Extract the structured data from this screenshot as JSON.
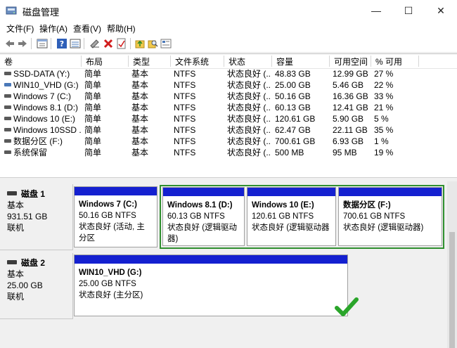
{
  "window": {
    "title": "磁盘管理",
    "minimize": "—",
    "maximize": "☐",
    "close": "✕"
  },
  "menu": [
    "文件(F)",
    "操作(A)",
    "查看(V)",
    "帮助(H)"
  ],
  "toolbar_icons": [
    "back-arrow-icon",
    "forward-arrow-icon",
    "console-icon",
    "help-icon",
    "properties-icon",
    "map-drive-icon",
    "delete-icon",
    "check-icon",
    "up-folder-icon",
    "search-icon",
    "details-icon"
  ],
  "volume_table": {
    "headers": [
      "卷",
      "布局",
      "类型",
      "文件系统",
      "状态",
      "容量",
      "可用空间",
      "% 可用"
    ],
    "rows": [
      [
        "SSD-DATA (Y:)",
        "简单",
        "基本",
        "NTFS",
        "状态良好 (...",
        "48.83 GB",
        "12.99 GB",
        "27 %"
      ],
      [
        "WIN10_VHD (G:)",
        "简单",
        "基本",
        "NTFS",
        "状态良好 (...",
        "25.00 GB",
        "5.46 GB",
        "22 %"
      ],
      [
        "Windows 7 (C:)",
        "简单",
        "基本",
        "NTFS",
        "状态良好 (...",
        "50.16 GB",
        "16.36 GB",
        "33 %"
      ],
      [
        "Windows 8.1 (D:)",
        "简单",
        "基本",
        "NTFS",
        "状态良好 (...",
        "60.13 GB",
        "12.41 GB",
        "21 %"
      ],
      [
        "Windows 10 (E:)",
        "简单",
        "基本",
        "NTFS",
        "状态良好 (...",
        "120.61 GB",
        "5.90 GB",
        "5 %"
      ],
      [
        "Windows 10SSD ...",
        "简单",
        "基本",
        "NTFS",
        "状态良好 (...",
        "62.47 GB",
        "22.11 GB",
        "35 %"
      ],
      [
        "数据分区 (F:)",
        "简单",
        "基本",
        "NTFS",
        "状态良好 (...",
        "700.61 GB",
        "6.93 GB",
        "1 %"
      ],
      [
        "系统保留",
        "简单",
        "基本",
        "NTFS",
        "状态良好 (...",
        "500 MB",
        "95 MB",
        "19 %"
      ]
    ]
  },
  "disks": [
    {
      "name": "磁盘 1",
      "type": "基本",
      "size": "931.51 GB",
      "status": "联机",
      "partitions": [
        {
          "name": "Windows 7  (C:)",
          "size": "50.16 GB NTFS",
          "status": "状态良好 (活动, 主分区"
        },
        {
          "name": "Windows 8.1  (D:)",
          "size": "60.13 GB NTFS",
          "status": "状态良好 (逻辑驱动器)"
        },
        {
          "name": "Windows 10  (E:)",
          "size": "120.61 GB NTFS",
          "status": "状态良好 (逻辑驱动器"
        },
        {
          "name": "数据分区  (F:)",
          "size": "700.61 GB NTFS",
          "status": "状态良好 (逻辑驱动器)"
        }
      ]
    },
    {
      "name": "磁盘 2",
      "type": "基本",
      "size": "25.00 GB",
      "status": "联机",
      "partitions": [
        {
          "name": "WIN10_VHD  (G:)",
          "size": "25.00 GB NTFS",
          "status": "状态良好 (主分区)"
        }
      ]
    }
  ],
  "colors": {
    "partition_bar": "#1420d0",
    "extended_border": "#2f8f2f",
    "checkmark": "#2aa52a"
  }
}
